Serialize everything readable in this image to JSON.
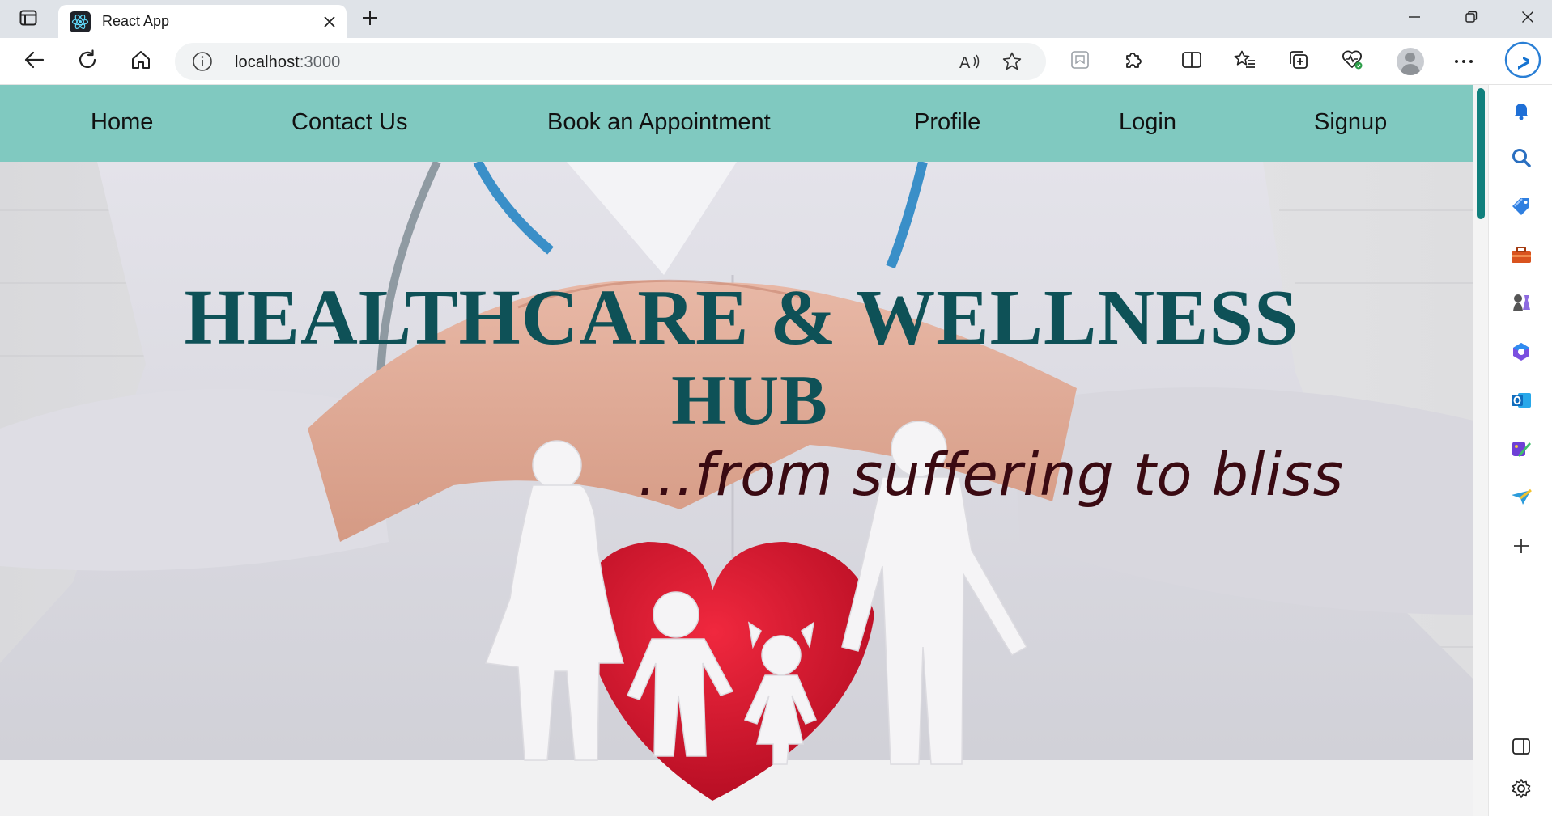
{
  "browser": {
    "tab": {
      "title": "React App",
      "favicon": "react-logo-icon"
    },
    "address": {
      "host": "localhost",
      "port": ":3000"
    },
    "toolbar_icons": [
      "back-arrow-icon",
      "refresh-icon",
      "home-icon",
      "info-icon",
      "read-aloud-icon",
      "favorite-star-icon",
      "extension-icon",
      "puzzle-icon",
      "split-screen-icon",
      "favorites-icon",
      "collections-icon",
      "browser-essentials-icon",
      "profile-avatar",
      "more-icon",
      "bing-copilot-icon"
    ],
    "sidebar_icons": [
      "bell-icon",
      "search-icon",
      "shopping-tag-icon",
      "tools-icon",
      "games-icon",
      "microsoft365-icon",
      "outlook-icon",
      "designer-icon",
      "send-icon",
      "add-icon",
      "hide-sidebar-icon",
      "settings-icon"
    ],
    "colors": {
      "tab_strip": "#dfe3e8",
      "scroll_thumb": "#11807d"
    }
  },
  "page": {
    "nav": {
      "items": [
        "Home",
        "Contact Us",
        "Book an Appointment",
        "Profile",
        "Login",
        "Signup"
      ],
      "background": "#80c9c0"
    },
    "hero": {
      "title_line1": "HEALTHCARE & WELLNESS",
      "title_line2": "HUB",
      "tagline": "...from suffering to bliss",
      "title_color": "#0e5157",
      "tagline_color": "#3a0a12",
      "heart_color": "#d8122b"
    }
  }
}
